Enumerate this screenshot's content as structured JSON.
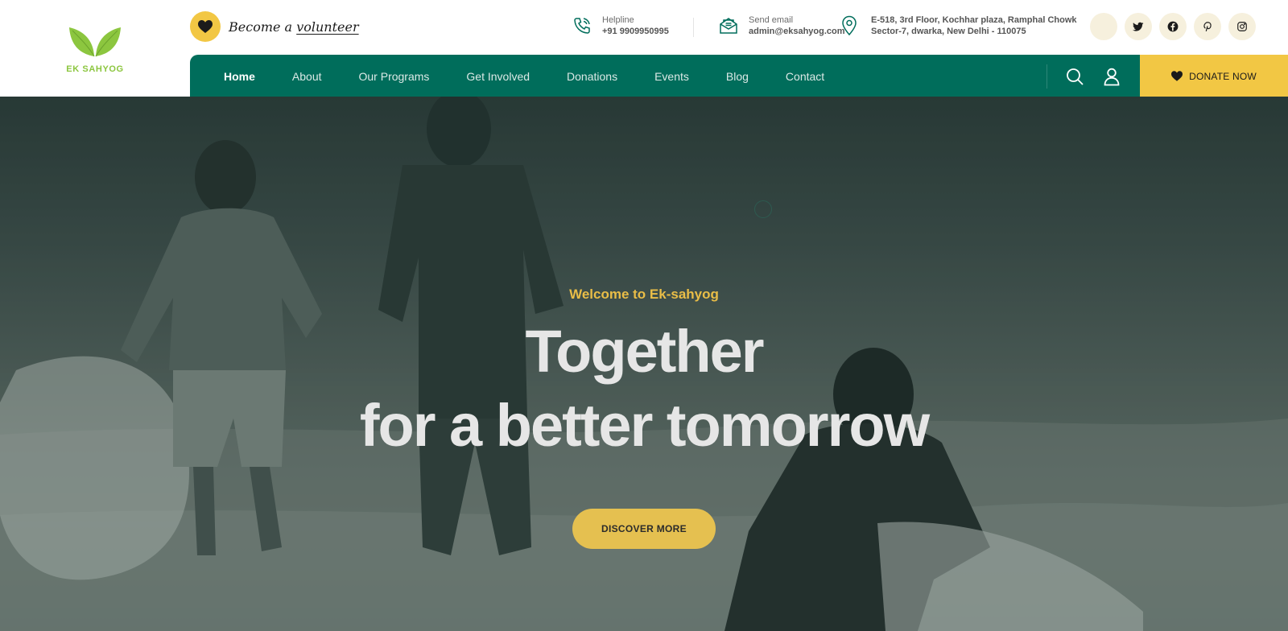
{
  "brand": {
    "name": "EK SAHYOG",
    "leaf_color": "#8cc63f"
  },
  "volunteer": {
    "prefix": "Become a",
    "link": "volunteer",
    "badge_color": "#f2c744"
  },
  "contact": {
    "helpline_label": "Helpline",
    "helpline_value": "+91 9909950995",
    "email_label": "Send email",
    "email_value": "admin@eksahyog.com",
    "address_line1": "E-518, 3rd Floor, Kochhar plaza, Ramphal Chowk",
    "address_line2": "Sector-7, dwarka, New Delhi - 110075",
    "icon_color": "#006d5b"
  },
  "socials": [
    "blank",
    "twitter-icon",
    "facebook-icon",
    "pinterest-icon",
    "instagram-icon"
  ],
  "nav": {
    "items": [
      "Home",
      "About",
      "Our Programs",
      "Get Involved",
      "Donations",
      "Events",
      "Blog",
      "Contact"
    ],
    "active": "Home",
    "background": "#006d5b"
  },
  "donate": {
    "label": "DONATE NOW",
    "color": "#f2c744"
  },
  "hero": {
    "welcome": "Welcome to Ek-sahyog",
    "title_line1": "Together",
    "title_line2": "for a better tomorrow",
    "cta": "DISCOVER MORE",
    "accent": "#e9bd47"
  }
}
